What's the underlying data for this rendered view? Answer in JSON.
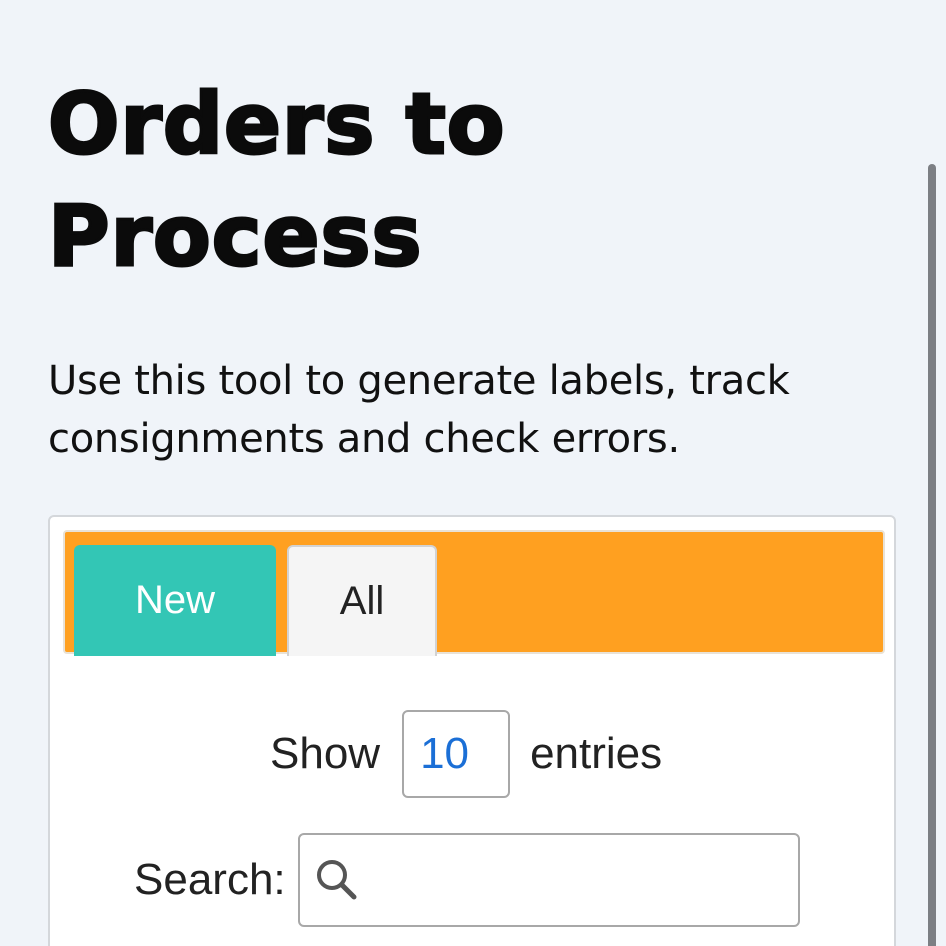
{
  "header": {
    "title": "Orders to Process",
    "description": "Use this tool to generate labels, track consignments and check errors."
  },
  "tabs": [
    {
      "label": "New",
      "active": true
    },
    {
      "label": "All",
      "active": false
    }
  ],
  "table_controls": {
    "show_label": "Show",
    "entries_value": "10",
    "entries_label": "entries",
    "search_label": "Search:",
    "search_value": ""
  },
  "icons": {
    "search": "search-icon"
  },
  "colors": {
    "tab_bar": "#ffa020",
    "active_tab": "#33c6b5",
    "inactive_tab": "#f5f5f5",
    "page_background": "#f0f4f9",
    "select_value": "#1b6fd6"
  }
}
